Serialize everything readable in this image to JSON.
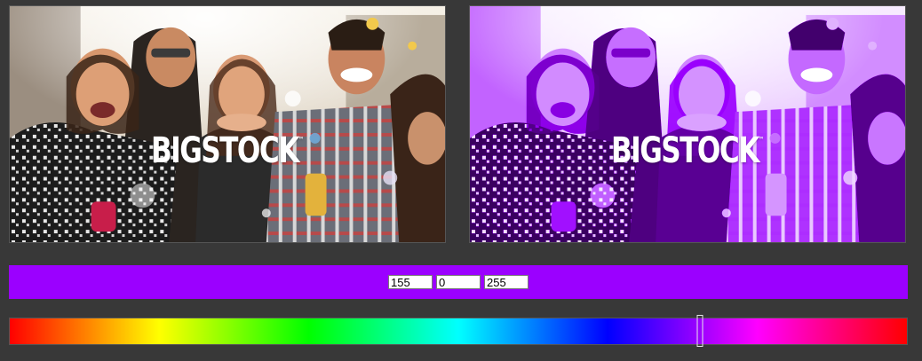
{
  "images": {
    "original": {
      "watermark": "BIGSTOCK",
      "trademark": "™"
    },
    "tinted": {
      "watermark": "BIGSTOCK",
      "trademark": "™"
    }
  },
  "color": {
    "hex": "#9b00ff",
    "r": "155",
    "g": "0",
    "b": "255"
  },
  "hue_slider": {
    "value_fraction": 0.7695
  },
  "icons": {
    "photo": "photo-image",
    "handle": "slider-handle"
  }
}
